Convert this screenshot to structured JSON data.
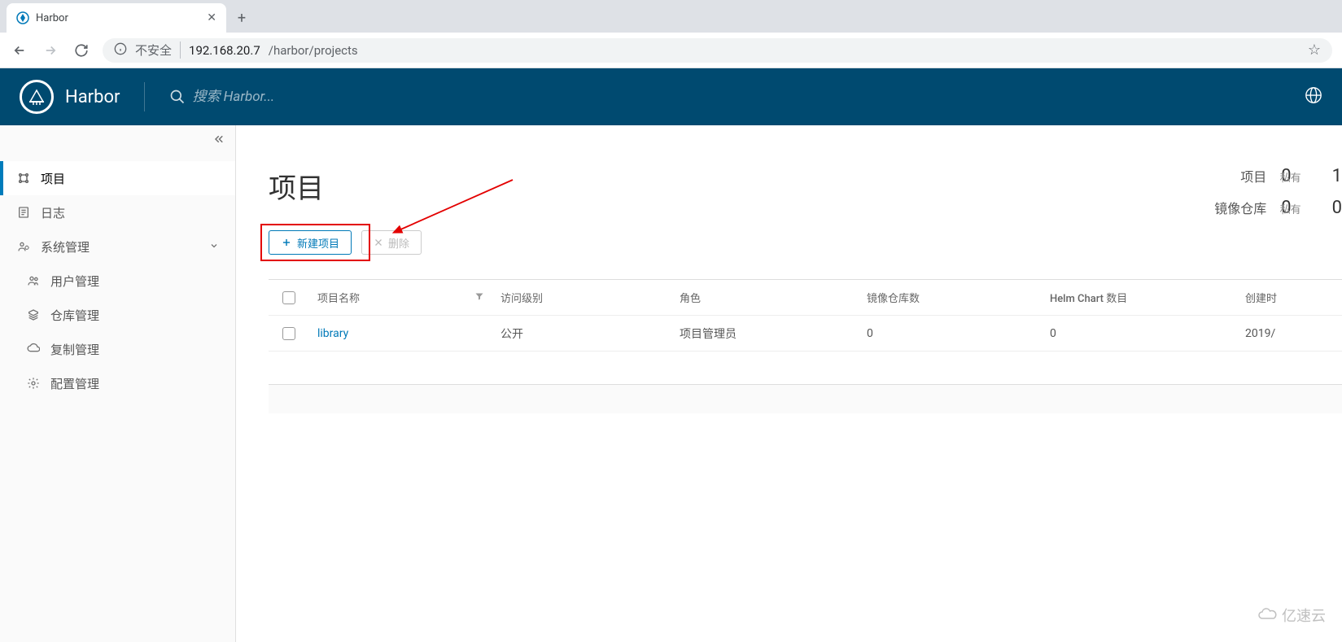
{
  "browser": {
    "tab_title": "Harbor",
    "insecure_label": "不安全",
    "url_host": "192.168.20.7",
    "url_path": "/harbor/projects"
  },
  "header": {
    "brand": "Harbor",
    "search_placeholder": "搜索 Harbor..."
  },
  "sidebar": {
    "projects": "项目",
    "logs": "日志",
    "admin": "系统管理",
    "users": "用户管理",
    "registries": "仓库管理",
    "replication": "复制管理",
    "config": "配置管理"
  },
  "main": {
    "title": "项目",
    "stats": {
      "projects_label": "项目",
      "projects_count": "0",
      "projects_unit": "私有",
      "projects_extra": "1",
      "repos_label": "镜像仓库",
      "repos_count": "0",
      "repos_unit": "私有",
      "repos_extra": "0"
    },
    "actions": {
      "new_project": "新建项目",
      "delete": "删除"
    },
    "table": {
      "headers": {
        "name": "项目名称",
        "access": "访问级别",
        "role": "角色",
        "repos": "镜像仓库数",
        "helm": "Helm Chart 数目",
        "created": "创建时"
      },
      "rows": [
        {
          "name": "library",
          "access": "公开",
          "role": "项目管理员",
          "repos": "0",
          "helm": "0",
          "created": "2019/"
        }
      ]
    }
  },
  "watermark": "亿速云"
}
